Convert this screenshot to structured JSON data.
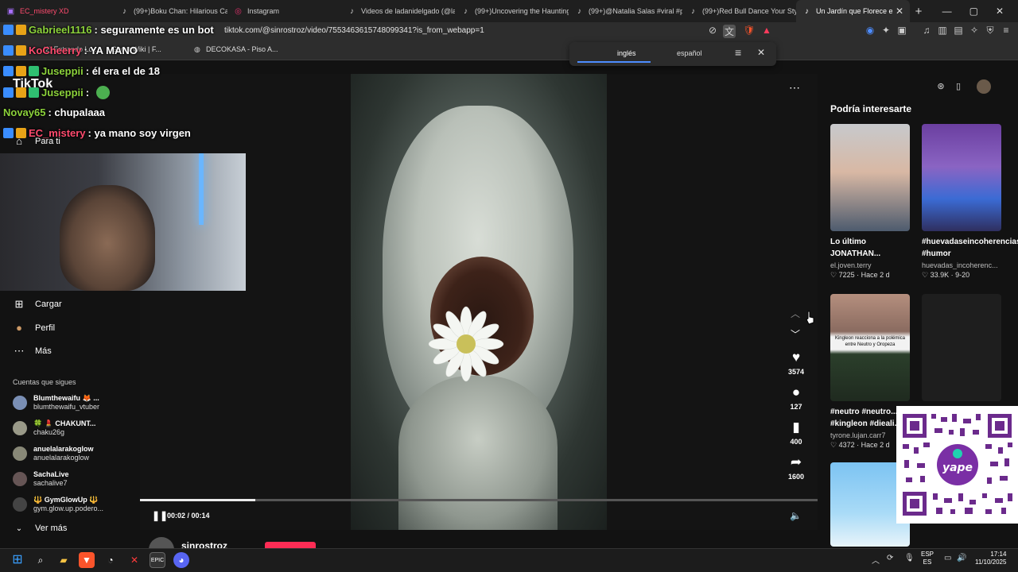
{
  "browser": {
    "tabs": [
      {
        "label": "EC_mistery XD",
        "icon": "twitch-icon"
      },
      {
        "label": "(99+)Boku Chan: Hilarious Cat",
        "icon": "tiktok-icon"
      },
      {
        "label": "Instagram",
        "icon": "instagram-icon"
      },
      {
        "label": "Videos de ladanidelgado (@la",
        "icon": "tiktok-icon"
      },
      {
        "label": "(99+)Uncovering the Haunting",
        "icon": "tiktok-icon"
      },
      {
        "label": "(99+)@Natalia Salas #viral #pa",
        "icon": "tiktok-icon"
      },
      {
        "label": "(99+)Red Bull Dance Your Style",
        "icon": "tiktok-icon"
      },
      {
        "label": "Un Jardín que Florece e",
        "icon": "tiktok-icon",
        "active": true
      }
    ],
    "new_tab": "+",
    "window_buttons": [
      "—",
      "▢",
      "✕"
    ],
    "url": "tiktok.com/@sinrostroz/video/7553463615748099341?is_from_webapp=1",
    "bookmarks": [
      "(2) Entrando Lo...",
      "Ghost Wiki | F...",
      "DECOKASA - Piso A..."
    ]
  },
  "translate": {
    "source": "inglés",
    "target": "español"
  },
  "nav": {
    "logo": "TikTok",
    "for_you": "Para ti",
    "upload": "Cargar",
    "profile": "Perfil",
    "more": "Más",
    "following_header": "Cuentas que sigues",
    "following": [
      {
        "name": "Blumthewaifu 🦊 ...",
        "handle": "blumthewaifu_vtuber"
      },
      {
        "name": "🍀 💄 CHAKUNT...",
        "handle": "chaku26g"
      },
      {
        "name": "anuelalarakoglow",
        "handle": "anuelalarakoglow"
      },
      {
        "name": "SachaLive",
        "handle": "sachalive7"
      },
      {
        "name": "🔱 GymGlowUp 🔱",
        "handle": "gym.glow.up.podero..."
      }
    ],
    "see_more": "Ver más"
  },
  "video": {
    "likes": "3574",
    "comments": "127",
    "saves": "400",
    "shares": "1600",
    "time": "00:02 / 00:14",
    "progress": 0.17,
    "author": "sinrostroz"
  },
  "recommended": {
    "title": "Podría interesarte",
    "cards": [
      {
        "title": "Lo último JONATHAN...",
        "user": "el.joven.terry",
        "stats": "♡ 7225 · Hace 2 d"
      },
      {
        "title": "#huevadaseincoherencias #humor",
        "user": "huevadas_incoherenc...",
        "stats": "♡ 33.9K · 9-20"
      },
      {
        "title": "#neutro #neutro... #kingleon #dieali...",
        "user": "tyrone.lujan.carr7",
        "stats": "♡ 4372 · Hace 2 d"
      },
      {
        "title": "",
        "user": "",
        "stats": ""
      }
    ],
    "thumb_caption": "Kingleon reacciona a la polémica entre Neutro y Oropeza"
  },
  "qr": {
    "brand": "yape"
  },
  "chat": [
    {
      "user": "Gabrieel1116",
      "msg": ": seguramente es un bot",
      "color": "#8cd23b"
    },
    {
      "user": "KoCheerry",
      "msg": ": YA MANO",
      "color": "#ff4b6e"
    },
    {
      "user": "Juseppii",
      "msg": ": él era el de 18",
      "color": "#8cd23b"
    },
    {
      "user": "Juseppii",
      "msg": ":",
      "color": "#8cd23b"
    },
    {
      "user": "Novay65",
      "msg": ": chupalaaa",
      "color": "#8cd23b"
    },
    {
      "user": "EC_mistery",
      "msg": ": ya mano soy virgen",
      "color": "#ff4b6e"
    }
  ],
  "taskbar": {
    "lang_top": "ESP",
    "lang_bottom": "ES",
    "time": "17:14",
    "date": "11/10/2025"
  }
}
